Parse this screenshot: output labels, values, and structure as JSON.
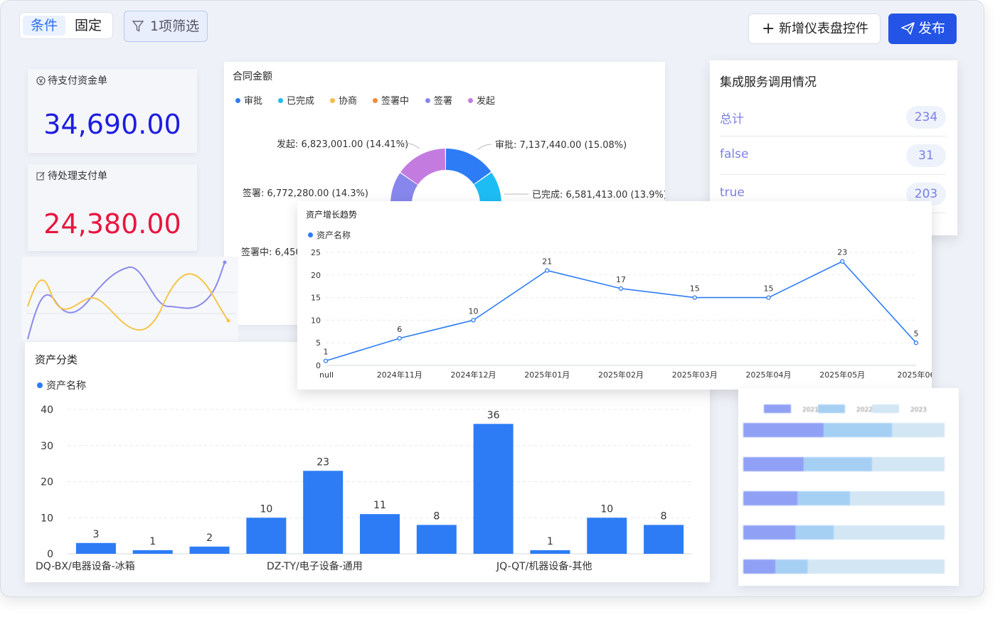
{
  "toolbar": {
    "tab_condition": "条件",
    "tab_fixed": "固定",
    "filter_label": "1项筛选",
    "add_widget_label": "新增仪表盘控件",
    "publish_label": "发布"
  },
  "kpis": [
    {
      "title": "待支付资金单",
      "value": "34,690.00",
      "color": "#1d1de0"
    },
    {
      "title": "待处理支付单",
      "value": "24,380.00",
      "color": "#e8163f"
    }
  ],
  "contract": {
    "title": "合同金额",
    "legend": [
      {
        "name": "审批",
        "color": "#2d7cf6"
      },
      {
        "name": "已完成",
        "color": "#1ebcf5"
      },
      {
        "name": "协商",
        "color": "#f4be4a"
      },
      {
        "name": "签署中",
        "color": "#f08a3c"
      },
      {
        "name": "签署",
        "color": "#8686ec"
      },
      {
        "name": "发起",
        "color": "#c47be0"
      }
    ],
    "labels": [
      "发起: 6,823,001.00 (14.41%)",
      "审批: 7,137,440.00 (15.08%)",
      "签署: 6,772,280.00 (14.3%)",
      "已完成: 6,581,413.00 (13.9%)",
      "签署中: 6,450"
    ]
  },
  "service": {
    "title": "集成服务调用情况",
    "rows": [
      {
        "name": "总计",
        "count": "234"
      },
      {
        "name": "false",
        "count": "31"
      },
      {
        "name": "true",
        "count": "203"
      }
    ]
  },
  "growth": {
    "title": "资产增长趋势",
    "legend": "资产名称",
    "color": "#2d7cf6",
    "chart_data": {
      "type": "line",
      "x": [
        "null",
        "2024年11月",
        "2024年12月",
        "2025年01月",
        "2025年02月",
        "2025年03月",
        "2025年04月",
        "2025年05月",
        "2025年06"
      ],
      "y": [
        1,
        6,
        10,
        21,
        17,
        15,
        15,
        23,
        5
      ],
      "yticks": [
        0,
        5,
        10,
        15,
        20,
        25
      ],
      "ylim": [
        0,
        25
      ]
    }
  },
  "category": {
    "title": "资产分类",
    "legend": "资产名称",
    "color": "#2d7cf6",
    "xlabels": [
      "DQ-BX/电器设备-冰箱",
      "DZ-TY/电子设备-通用",
      "JQ-QT/机器设备-其他"
    ],
    "chart_data": {
      "type": "bar",
      "values": [
        3,
        1,
        2,
        10,
        23,
        11,
        8,
        36,
        1,
        10,
        8
      ],
      "yticks": [
        0,
        10,
        20,
        30,
        40
      ],
      "ylim": [
        0,
        40
      ]
    }
  },
  "blurred_bars": {
    "legend": [
      "2021",
      "2022",
      "2023"
    ],
    "colors": [
      "#8fa0f5",
      "#a6cff4",
      "#d2e6f4"
    ],
    "rows": [
      [
        40,
        34,
        26
      ],
      [
        30,
        34,
        36
      ],
      [
        27,
        26,
        47
      ],
      [
        26,
        19,
        55
      ],
      [
        16,
        16,
        68
      ]
    ]
  },
  "decor_wave": {
    "colors": [
      "#8b8bec",
      "#f3c54a"
    ]
  }
}
